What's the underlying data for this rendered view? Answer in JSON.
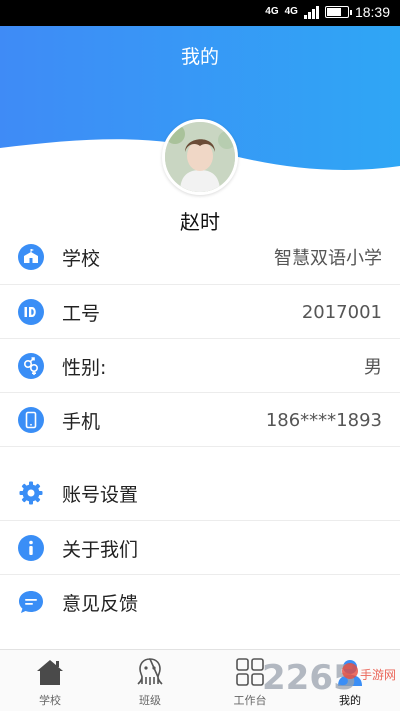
{
  "status_bar": {
    "network_1": "4G",
    "network_2": "4G",
    "time": "18:39"
  },
  "header": {
    "title": "我的"
  },
  "user": {
    "name": "赵时"
  },
  "info_rows": [
    {
      "icon": "school-icon",
      "label": "学校",
      "value": "智慧双语小学"
    },
    {
      "icon": "id-icon",
      "label": "工号",
      "value": "2017001"
    },
    {
      "icon": "gender-icon",
      "label": "性别:",
      "value": "男"
    },
    {
      "icon": "phone-icon",
      "label": "手机",
      "value": "186****1893"
    }
  ],
  "menu_rows": [
    {
      "icon": "gear-icon",
      "label": "账号设置"
    },
    {
      "icon": "info-icon",
      "label": "关于我们"
    },
    {
      "icon": "feedback-icon",
      "label": "意见反馈"
    }
  ],
  "bottom_nav": [
    {
      "icon": "home-icon",
      "label": "学校"
    },
    {
      "icon": "class-icon",
      "label": "班级"
    },
    {
      "icon": "workbench-icon",
      "label": "工作台"
    },
    {
      "icon": "profile-icon",
      "label": "我的"
    }
  ],
  "watermark": {
    "text": "2265",
    "sub": "手游网"
  },
  "colors": {
    "accent": "#3a8ef6",
    "header_start": "#3f8bf6",
    "header_end": "#2fa6f5"
  }
}
